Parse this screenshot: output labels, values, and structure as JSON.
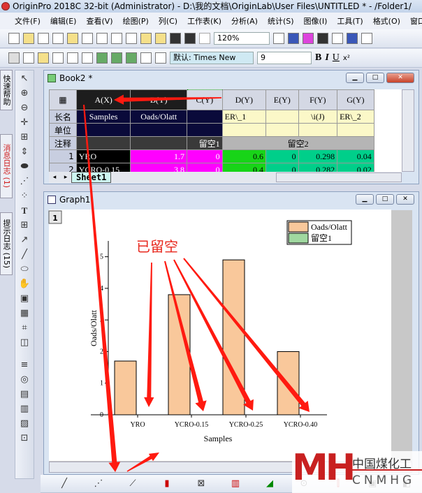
{
  "app": {
    "title": "OriginPro 2018C 32-bit (Administrator) - D:\\我的文档\\OriginLab\\User Files\\UNTITLED * - /Folder1/"
  },
  "menu": [
    "文件(F)",
    "编辑(E)",
    "查看(V)",
    "绘图(P)",
    "列(C)",
    "工作表(K)",
    "分析(A)",
    "统计(S)",
    "图像(I)",
    "工具(T)",
    "格式(O)",
    "窗口"
  ],
  "toolbar": {
    "zoom": "120%",
    "font": "默认: Times New",
    "font_size": "9",
    "bold": "B",
    "italic": "I",
    "underline": "U",
    "superscript": "x²"
  },
  "dock": {
    "tabs": [
      "快速帮助",
      "消息日志 (1)",
      "提示日志 (15)"
    ]
  },
  "book": {
    "title": "Book2 *",
    "columns": [
      "A(X)",
      "B(Y)",
      "C(Y)",
      "D(Y)",
      "E(Y)",
      "F(Y)",
      "G(Y)"
    ],
    "row_labels": {
      "long_name": "长名",
      "units": "单位",
      "comments": "注释"
    },
    "long_names": [
      "Samples",
      "Oads/Olatt",
      "",
      "ER\\_1",
      "",
      "\\i(J)",
      "ER\\_2"
    ],
    "comments": [
      "",
      "",
      "留空1",
      "留空2"
    ],
    "rows": [
      {
        "n": "1",
        "cells": [
          "YRO",
          "1.7",
          "0",
          "0.6",
          "0",
          "0.298",
          "0.04"
        ]
      },
      {
        "n": "2",
        "cells": [
          "YCRO-0.15",
          "3.8",
          "0",
          "0.4",
          "0",
          "0.282",
          "0.02"
        ]
      }
    ],
    "sheet_tab": "Sheet1"
  },
  "graph": {
    "title": "Graph1",
    "layer": "1",
    "annotation": "已留空"
  },
  "chart_data": {
    "type": "bar",
    "categories": [
      "YRO",
      "YCRO-0.15",
      "YCRO-0.25",
      "YCRO-0.40"
    ],
    "series": [
      {
        "name": "Oads/Olatt",
        "values": [
          1.7,
          3.8,
          4.9,
          2.0
        ],
        "color": "#f9c89b"
      },
      {
        "name": "留空1",
        "values": [
          0,
          0,
          0,
          0
        ],
        "color": "#a0d8a0"
      }
    ],
    "xlabel": "Samples",
    "ylabel": "Oads/Olatt",
    "ylim": [
      0,
      5.5
    ],
    "yticks": [
      0,
      1,
      2,
      3,
      4,
      5
    ],
    "legend": "top-right",
    "grid": false
  },
  "watermark": {
    "logo": "MH",
    "text1": "中国煤化工",
    "text2": "CNMHG"
  },
  "colors": {
    "annotation": "#e8281e",
    "title_bg": "#c3d4ea"
  }
}
